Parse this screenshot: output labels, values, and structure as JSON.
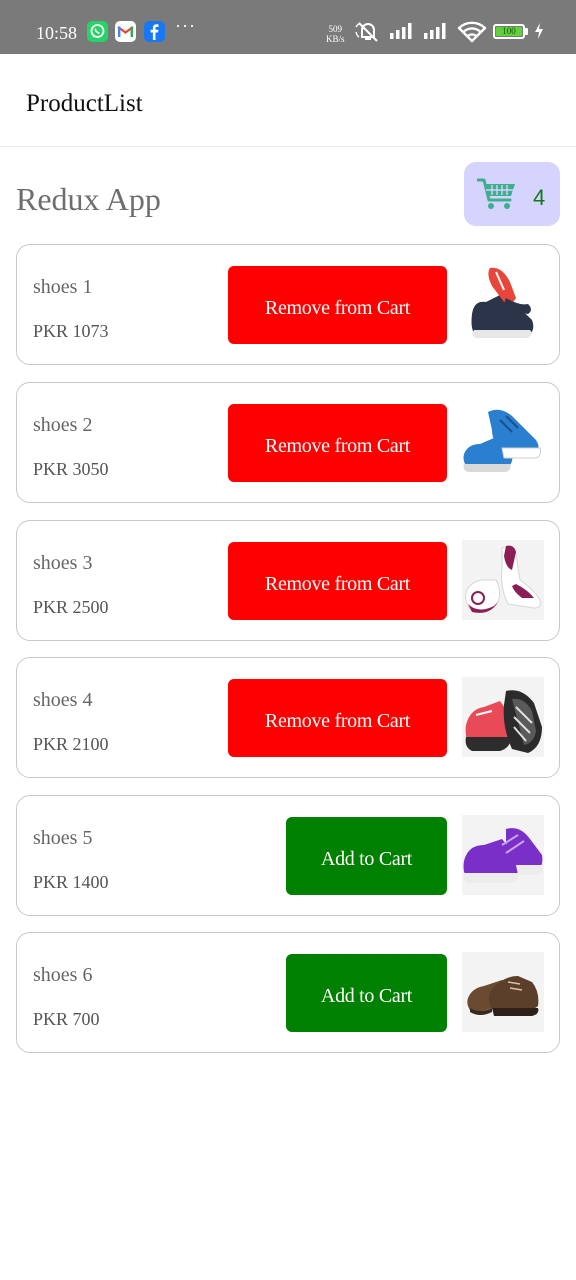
{
  "status_bar": {
    "time": "10:58",
    "apps": [
      "whatsapp-icon",
      "gmail-icon",
      "facebook-icon"
    ],
    "more": "···",
    "net_speed_value": "509",
    "net_speed_unit": "KB/s",
    "battery_level": "100",
    "colors": {
      "background": "#7a7a7a",
      "whatsapp": "#25d366",
      "facebook": "#1877f2",
      "battery": "#5fd13a"
    }
  },
  "header": {
    "title": "ProductList"
  },
  "page": {
    "title": "Redux App"
  },
  "cart": {
    "icon": "shopping-cart-icon",
    "count": "4",
    "badge_color": "#d4d4ff",
    "count_color": "#0e7a1a"
  },
  "products": [
    {
      "name": "shoes 1",
      "price": "PKR 1073",
      "button_label": "Remove from Cart",
      "in_cart": true,
      "image": "shoe-image-1"
    },
    {
      "name": "shoes 2",
      "price": "PKR 3050",
      "button_label": "Remove from Cart",
      "in_cart": true,
      "image": "shoe-image-2"
    },
    {
      "name": "shoes 3",
      "price": "PKR 2500",
      "button_label": "Remove from Cart",
      "in_cart": true,
      "image": "shoe-image-3"
    },
    {
      "name": "shoes 4",
      "price": "PKR 2100",
      "button_label": "Remove from Cart",
      "in_cart": true,
      "image": "shoe-image-4"
    },
    {
      "name": "shoes 5",
      "price": "PKR 1400",
      "button_label": "Add to Cart",
      "in_cart": false,
      "image": "shoe-image-5"
    },
    {
      "name": "shoes 6",
      "price": "PKR 700",
      "button_label": "Add to Cart",
      "in_cart": false,
      "image": "shoe-image-6"
    }
  ],
  "colors": {
    "remove_button": "#ff0000",
    "add_button": "#008000"
  }
}
